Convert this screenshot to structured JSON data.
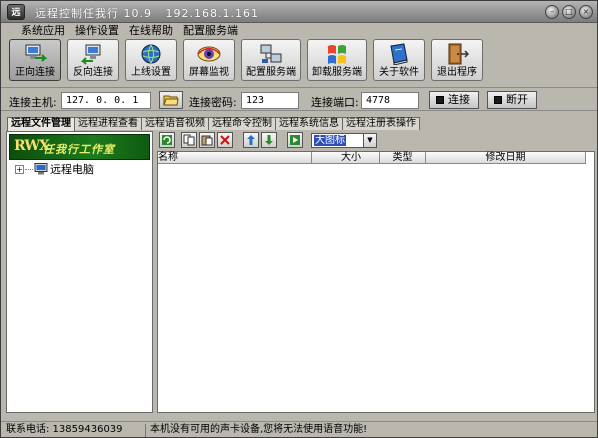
{
  "window": {
    "app_icon": "远",
    "title": "远程控制任我行 10.9   192.168.1.161",
    "buttons": [
      "minimize",
      "maximize",
      "close"
    ]
  },
  "menu": [
    "系统应用",
    "操作设置",
    "在线帮助",
    "配置服务端"
  ],
  "toolbar": [
    {
      "label": "正向连接",
      "icon": "forward-connect-icon",
      "active": true
    },
    {
      "label": "反向连接",
      "icon": "reverse-connect-icon",
      "active": false
    },
    {
      "label": "上线设置",
      "icon": "online-settings-icon",
      "active": false
    },
    {
      "label": "屏幕监视",
      "icon": "screen-monitor-icon",
      "active": false
    },
    {
      "label": "配置服务端",
      "icon": "config-server-icon",
      "active": false
    },
    {
      "label": "卸载服务端",
      "icon": "uninstall-server-icon",
      "active": false
    },
    {
      "label": "关于软件",
      "icon": "about-icon",
      "active": false
    },
    {
      "label": "退出程序",
      "icon": "exit-icon",
      "active": false
    }
  ],
  "connection": {
    "host_label": "连接主机:",
    "host_value": "127. 0. 0. 1",
    "password_label": "连接密码:",
    "password_value": "123",
    "port_label": "连接端口:",
    "port_value": "4778",
    "connect_label": "连接",
    "disconnect_label": "断开"
  },
  "tabs": [
    "远程文件管理",
    "远程进程查看",
    "远程语音视频",
    "远程命令控制",
    "远程系统信息",
    "远程注册表操作"
  ],
  "banner": {
    "logo": "RWX",
    "text": "任我行工作室"
  },
  "tree": {
    "expander": "+",
    "root_label": "远程电脑"
  },
  "file_toolbar": {
    "view_mode": "大图标"
  },
  "file_list": {
    "columns": [
      "名称",
      "大小",
      "类型",
      "修改日期"
    ],
    "rows": []
  },
  "status": {
    "phone": "联系电话: 13859436039",
    "message": "本机没有可用的声卡设备,您将无法使用语音功能!"
  },
  "colors": {
    "window_bg": "#b9b7ae",
    "banner_green": "#1d7a1d",
    "selection_blue": "#2d4dbb"
  }
}
